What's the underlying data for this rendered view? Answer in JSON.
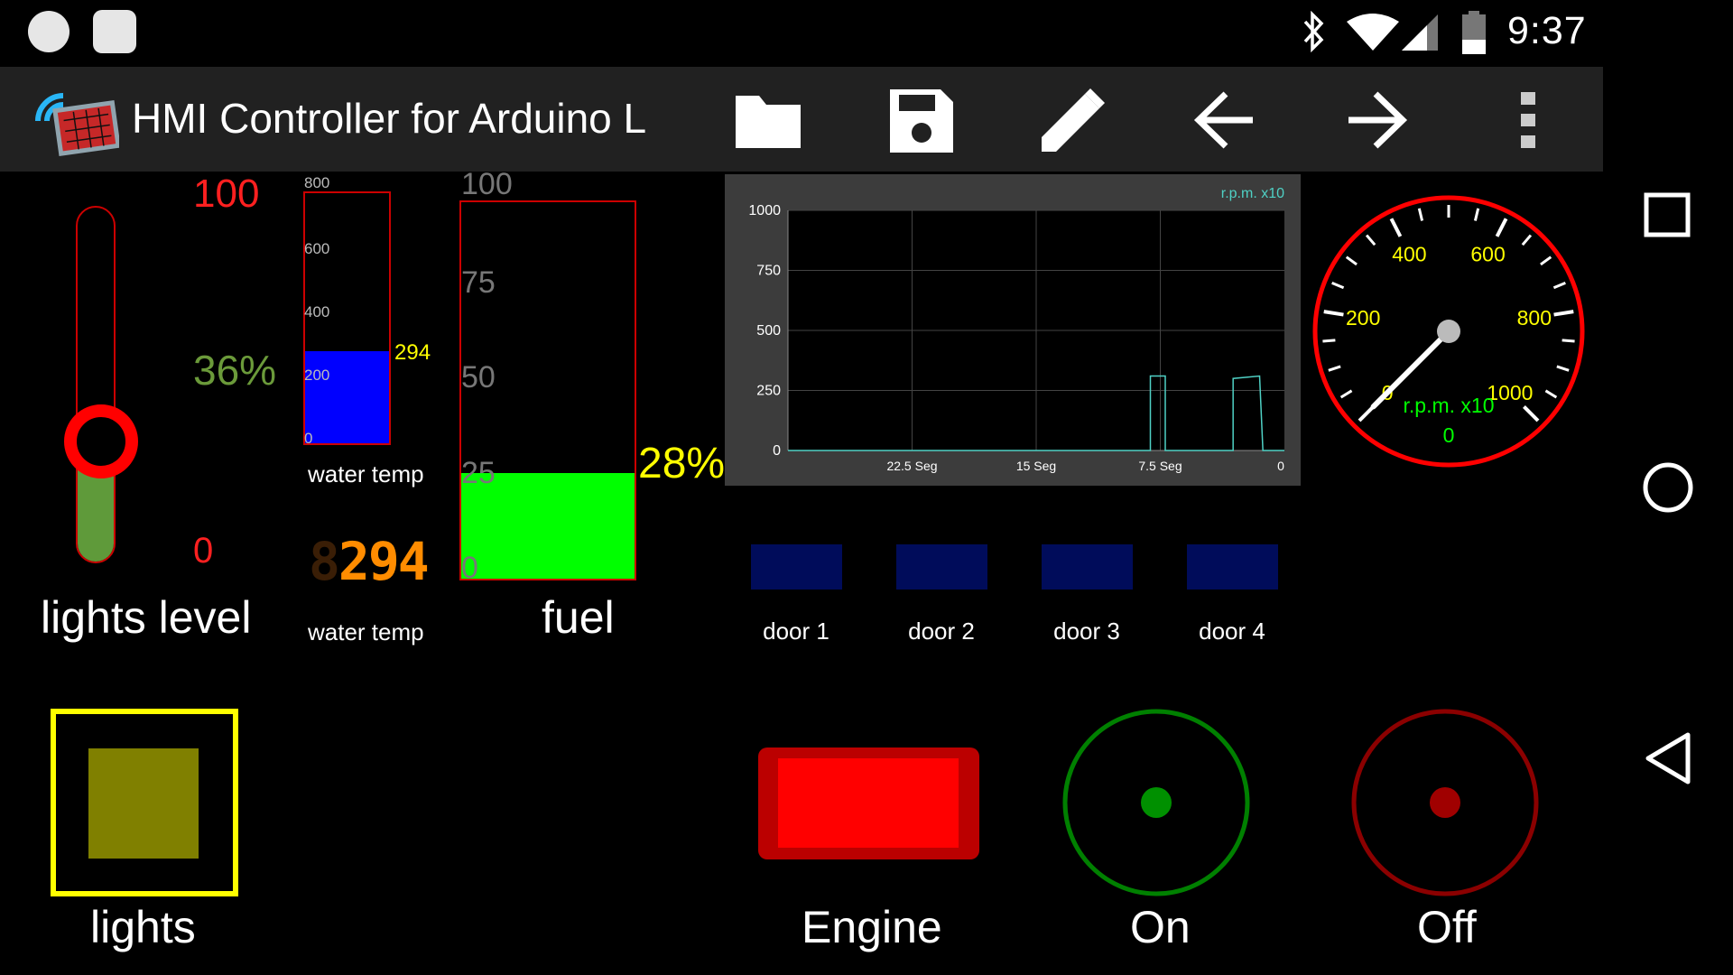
{
  "status_bar": {
    "time": "9:37"
  },
  "app": {
    "title": "HMI Controller for Arduino L"
  },
  "toolbar": {
    "icons": [
      "folder-icon",
      "save-icon",
      "edit-icon",
      "back-arrow-icon",
      "forward-arrow-icon",
      "overflow-menu-icon"
    ]
  },
  "lights_level": {
    "max_label": "100",
    "min_label": "0",
    "percent_label": "36%",
    "label": "lights level",
    "value_percent": 36
  },
  "water_temp_bar": {
    "ticks": [
      "800",
      "600",
      "400",
      "200",
      "0"
    ],
    "value": "294",
    "label": "water temp",
    "max": 800
  },
  "water_temp_display": {
    "value": "294",
    "ghost": "8",
    "label": "water temp"
  },
  "fuel": {
    "ticks": [
      "100",
      "75",
      "50",
      "25",
      "0"
    ],
    "percent_label": "28%",
    "label": "fuel",
    "value_percent": 28
  },
  "chart_data": {
    "type": "line",
    "title": "",
    "legend": "r.p.m. x10",
    "y_ticks": [
      "1000",
      "750",
      "500",
      "250",
      "0"
    ],
    "x_ticks": [
      "22.5 Seg",
      "15 Seg",
      "7.5 Seg",
      "0"
    ],
    "ylim": [
      0,
      1000
    ],
    "xlim": [
      30,
      0
    ],
    "series": [
      {
        "name": "r.p.m. x10",
        "color": "#4fd1c5",
        "points": [
          [
            30,
            0
          ],
          [
            8.1,
            0
          ],
          [
            8.1,
            310
          ],
          [
            7.2,
            310
          ],
          [
            7.2,
            0
          ],
          [
            3.1,
            0
          ],
          [
            3.1,
            300
          ],
          [
            1.5,
            310
          ],
          [
            1.3,
            0
          ],
          [
            0,
            0
          ]
        ]
      }
    ]
  },
  "gauge": {
    "labels": [
      "0",
      "200",
      "400",
      "600",
      "800",
      "1000"
    ],
    "unit": "r.p.m. x10",
    "value": "0",
    "needle_value": 0
  },
  "doors": [
    {
      "label": "door 1"
    },
    {
      "label": "door 2"
    },
    {
      "label": "door 3"
    },
    {
      "label": "door 4"
    }
  ],
  "buttons": {
    "lights": "lights",
    "engine": "Engine",
    "on": "On",
    "off": "Off"
  },
  "colors": {
    "accent_red": "#ff0000",
    "fill_green": "#00ff00",
    "water_blue": "#0000ff",
    "gauge_text": "#ffff00",
    "door_blue": "#000c5a"
  }
}
